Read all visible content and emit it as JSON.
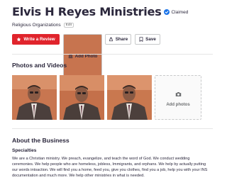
{
  "business": {
    "name": "Elvis H Reyes Ministries",
    "claimed_label": "Claimed",
    "category": "Religious Organizations",
    "edit_label": "Edit"
  },
  "actions": {
    "write_review": "Write a Review",
    "add_photo": "Add Photo",
    "share": "Share",
    "save": "Save"
  },
  "photos_section": {
    "title": "Photos and Videos",
    "add_photos_label": "Add photos",
    "photo_count": 3
  },
  "about": {
    "title": "About the Business",
    "specialties_title": "Specialties",
    "specialties_text": "We are a Christian ministry. We preach, evangelize, and teach the word of God. We conduct wedding ceremonies. We help people who are homeless, jobless, Immigrants, and orphans. We help by actually putting our words intoaction. We will find you a home, feed you, give you clothes, find you a job, help you with your INS documentation and much more. We help other ministries in what is needed."
  },
  "colors": {
    "primary_red": "#e0242c",
    "verified_blue": "#1a73e8",
    "text_dark": "#2b273c"
  },
  "icons": [
    "star-icon",
    "camera-icon",
    "share-icon",
    "bookmark-icon",
    "verified-check-icon"
  ]
}
